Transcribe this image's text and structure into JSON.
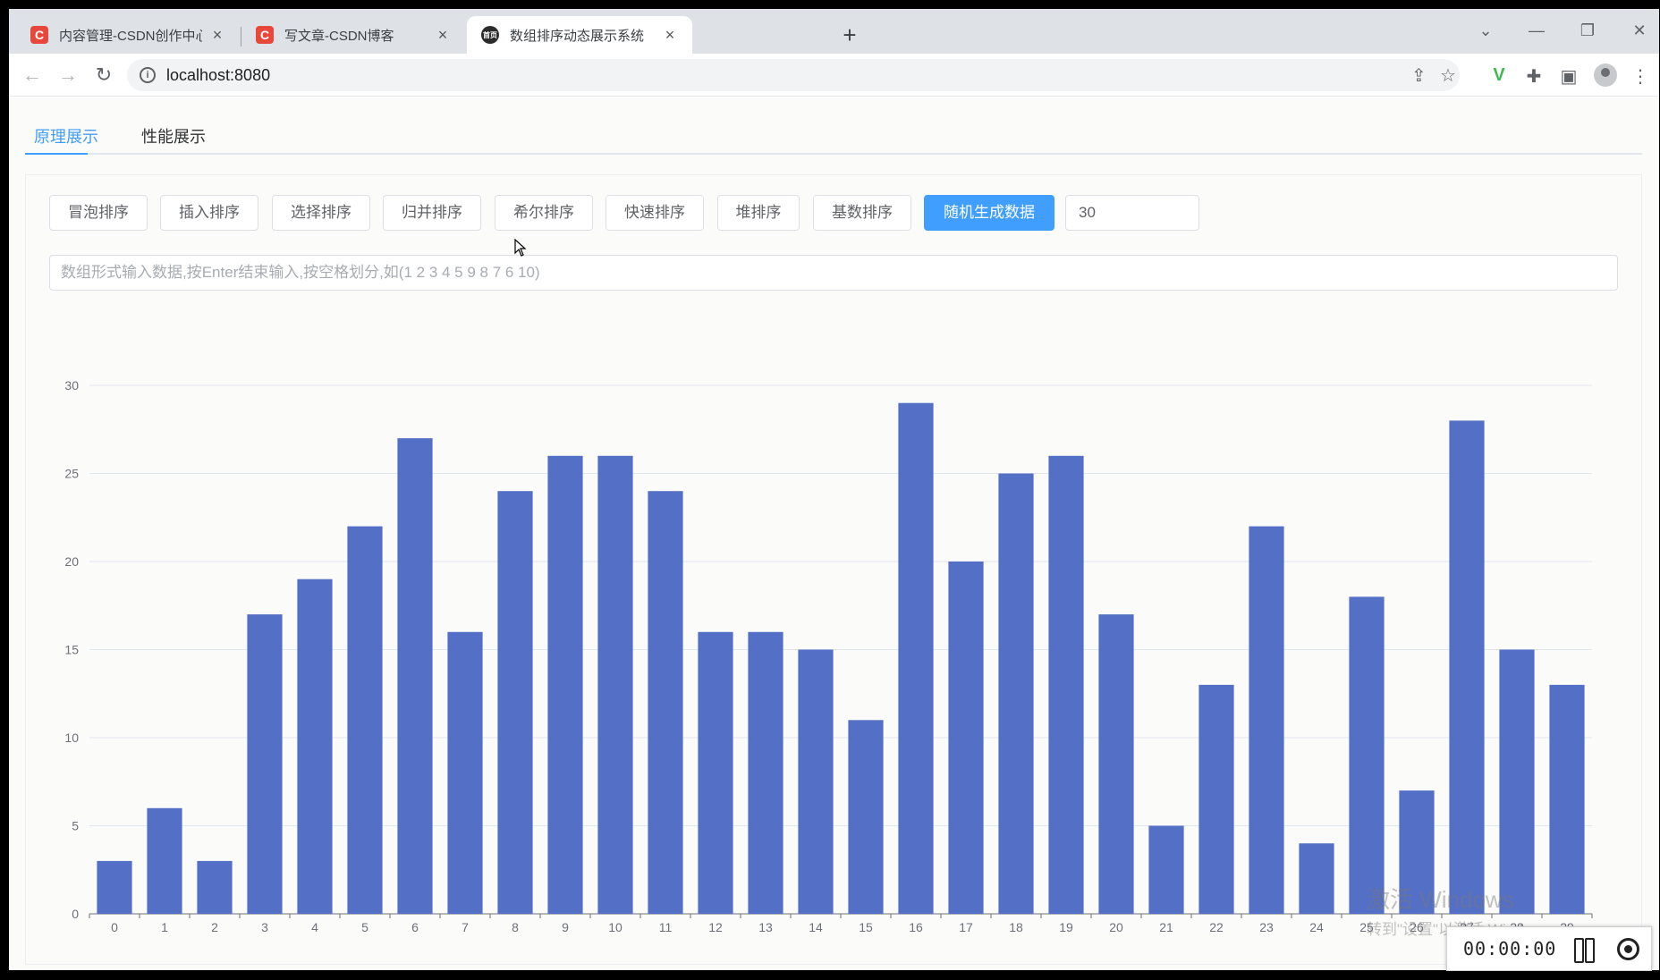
{
  "browser": {
    "tabs": [
      {
        "title": "内容管理-CSDN创作中心",
        "icon": "csdn-favicon",
        "favicon_text": "C"
      },
      {
        "title": "写文章-CSDN博客",
        "icon": "csdn-favicon",
        "favicon_text": "C"
      },
      {
        "title": "数组排序动态展示系统",
        "icon": "app-favicon",
        "favicon_text": "首页",
        "active": true
      }
    ],
    "close_glyph": "×",
    "new_tab_glyph": "+",
    "url": "localhost:8080",
    "window_controls": {
      "dropdown": "⌄",
      "minimize": "—",
      "restore": "❐",
      "close": "✕"
    }
  },
  "page": {
    "tabs": [
      {
        "label": "原理展示",
        "active": true
      },
      {
        "label": "性能展示",
        "active": false
      }
    ],
    "buttons": {
      "bubble": "冒泡排序",
      "insertion": "插入排序",
      "selection": "选择排序",
      "merge": "归并排序",
      "shell": "希尔排序",
      "quick": "快速排序",
      "heap": "堆排序",
      "radix": "基数排序",
      "random": "随机生成数据"
    },
    "count_value": "30",
    "array_placeholder": "数组形式输入数据,按Enter结束输入,按空格划分,如(1 2 3 4 5 9 8 7 6 10)",
    "accent_color": "#409eff",
    "bar_color": "#5470c6"
  },
  "chart_data": {
    "type": "bar",
    "categories": [
      "0",
      "1",
      "2",
      "3",
      "4",
      "5",
      "6",
      "7",
      "8",
      "9",
      "10",
      "11",
      "12",
      "13",
      "14",
      "15",
      "16",
      "17",
      "18",
      "19",
      "20",
      "21",
      "22",
      "23",
      "24",
      "25",
      "26",
      "27",
      "28",
      "29"
    ],
    "values": [
      3,
      6,
      3,
      17,
      19,
      22,
      27,
      16,
      24,
      26,
      26,
      24,
      16,
      16,
      15,
      11,
      29,
      20,
      25,
      26,
      17,
      5,
      13,
      22,
      4,
      18,
      7,
      28,
      15,
      13
    ],
    "yticks": [
      "0",
      "5",
      "10",
      "15",
      "20",
      "25",
      "30"
    ],
    "ylim": [
      0,
      30
    ],
    "grid": true
  },
  "watermark": {
    "line1": "激活 Windows",
    "line2": "转到\"设置\"以激活 Windows。"
  },
  "recorder": {
    "time": "00:00:00"
  }
}
